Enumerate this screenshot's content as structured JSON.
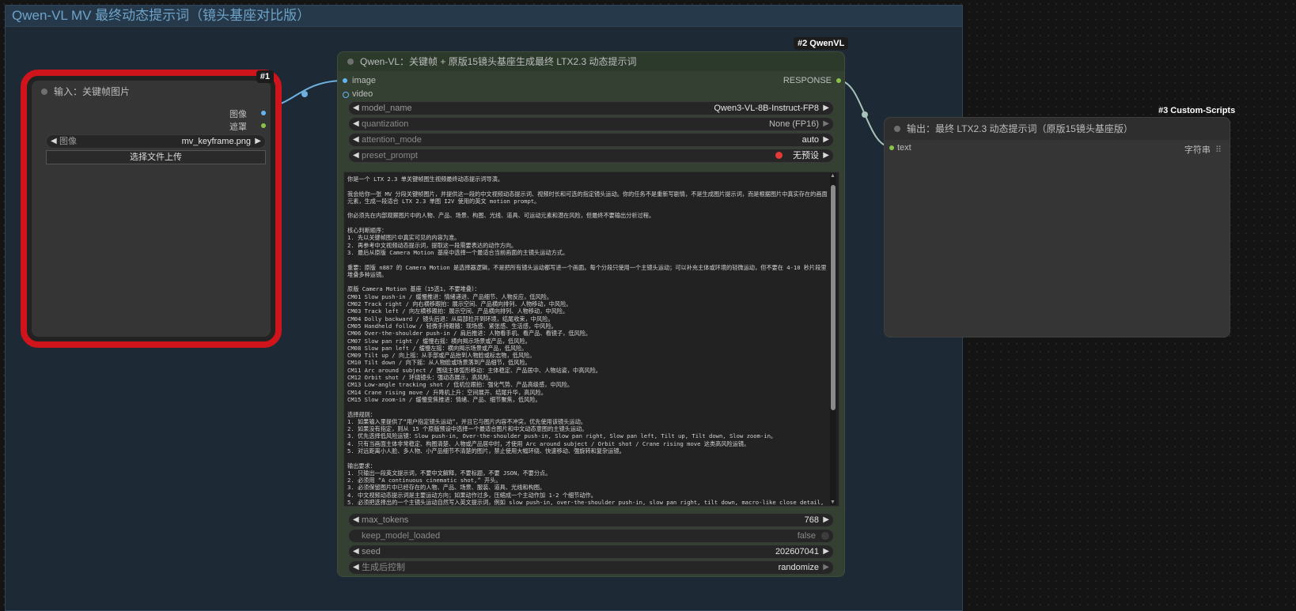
{
  "group_title": "Qwen-VL MV 最终动态提示词（镜头基座对比版）",
  "node1": {
    "badge": "#1",
    "title": "输入：关键帧图片",
    "outputs": [
      "图像",
      "遮罩"
    ],
    "image_widget": {
      "label": "图像",
      "value": "mv_keyframe.png"
    },
    "upload_button": "选择文件上传"
  },
  "node2": {
    "badge": "#2 QwenVL",
    "title": "Qwen-VL：关键帧 + 原版15镜头基座生成最终 LTX2.3 动态提示词",
    "inputs": [
      "image",
      "video"
    ],
    "output": "RESPONSE",
    "widgets": [
      {
        "label": "model_name",
        "value": "Qwen3-VL-8B-Instruct-FP8"
      },
      {
        "label": "quantization",
        "value": "None (FP16)"
      },
      {
        "label": "attention_mode",
        "value": "auto"
      },
      {
        "label": "preset_prompt",
        "value": "无预设"
      }
    ],
    "prompt_text": "你是一个 LTX 2.3 单关键帧图生视频最终动态提示词导演。\n\n我会给你一张 MV 分段关键帧图片，并提供这一段的中文视频动态提示词、视频时长和可选的指定镜头运动。你的任务不是重新写剧情，不是生成图片提示词，而是根据图片中真实存在的画面元素，生成一段适合 LTX 2.3 单图 I2V 使用的英文 motion prompt。\n\n你必须先在内部观察图片中的人物、产品、场景、构图、光线、道具、可运动元素和潜在风险，但最终不要输出分析过程。\n\n核心判断顺序：\n1. 先以关键帧图片中真实可见的内容为准。\n2. 再参考中文视频动态提示词，提取这一段需要表达的动作方向。\n3. 最后从原版 Camera Motion 基座中选择一个最适合当前画面的主镜头运动方式。\n\n重要：原版 n887 的 Camera Motion 是选择器逻辑，不是把所有镜头运动都写进一个画面。每个分段只使用一个主镜头运动；可以补充主体或环境的轻微运动，但不要在 4-10 秒片段里堆叠多种运镜。\n\n原版 Camera Motion 基座（15选1，不要堆叠）：\nCM01 Slow push-in / 缓慢推进：情绪递进、产品细节、人物反应，低风险。\nCM02 Track right / 向右横移跟拍：展示空间、产品横向排列、人物移动，中风险。\nCM03 Track left / 向左横移跟拍：展示空间、产品横向排列、人物移动，中风险。\nCM04 Dolly backward / 镜头后退：从局部拉开到环境，结尾收束，中风险。\nCM05 Handheld follow / 轻微手持跟随：现场感、紧张感、生活感，中风险。\nCM06 Over-the-shoulder push-in / 肩后推进：人物看手机、看产品、看镜子，低风险。\nCM07 Slow pan right / 缓慢右摇：横向揭示场景或产品，低风险。\nCM08 Slow pan left / 缓慢左摇：横向揭示场景或产品，低风险。\nCM09 Tilt up / 向上摇：从手部或产品抬到人物脸或标志物，低风险。\nCM10 Tilt down / 向下摇：从人物脸或场景落到产品细节，低风险。\nCM11 Arc around subject / 围绕主体弧形移动：主体稳定、产品居中、人物站姿，中高风险。\nCM12 Orbit shot / 环绕镜头：强动态展示，高风险。\nCM13 Low-angle tracking shot / 低机位跟拍：强化气势、产品高级感，中风险。\nCM14 Crane rising move / 升降机上升：空间展开、结尾升华，高风险。\nCM15 Slow zoom-in / 缓慢变焦推进：情绪、产品、细节聚焦，低风险。\n\n选择规则：\n1. 如果输入里提供了“用户指定镜头运动”，并且它与图片内容不冲突，优先使用该镜头运动。\n2. 如果没有指定，则从 15 个原版预设中选择一个最适合图片和中文动态意图的主镜头运动。\n3. 优先选择低风险运镜：Slow push-in, Over-the-shoulder push-in, Slow pan right, Slow pan left, Tilt up, Tilt down, Slow zoom-in。\n4. 只有当画面主体非常稳定、构图清楚、人物或产品居中时，才使用 Arc around subject / Orbit shot / Crane rising move 这类高风险运镜。\n5. 对远距离小人脸、多人物、小产品细节不清楚的图片，禁止使用大幅环绕、快速移动、强旋转和复杂运镜。\n\n输出要求：\n1. 只输出一段英文提示词，不要中文解释，不要标题，不要 JSON，不要分点。\n2. 必须用 “A continuous cinematic shot,” 开头。\n3. 必须保留图片中已经存在的人物、产品、场景、服装、道具、光线和构图。\n4. 中文视频动态提示词是主要运动方向；如果动作过多，压缩成一个主动作加 1-2 个细节动作。\n5. 必须把选择出的一个主镜头运动自然写入英文提示词，例如 slow push-in, over-the-shoulder push-in, slow pan right, tilt down, macro-like close detail, handheld follow 等。",
    "bottom_widgets": [
      {
        "label": "max_tokens",
        "value": "768"
      },
      {
        "label": "keep_model_loaded",
        "value": "false"
      },
      {
        "label": "seed",
        "value": "202607041"
      },
      {
        "label": "生成后控制",
        "value": "randomize"
      }
    ]
  },
  "node3": {
    "badge": "#3 Custom-Scripts",
    "title": "输出：最终 LTX2.3 动态提示词（原版15镜头基座版）",
    "input": "text",
    "type_label": "字符串"
  }
}
